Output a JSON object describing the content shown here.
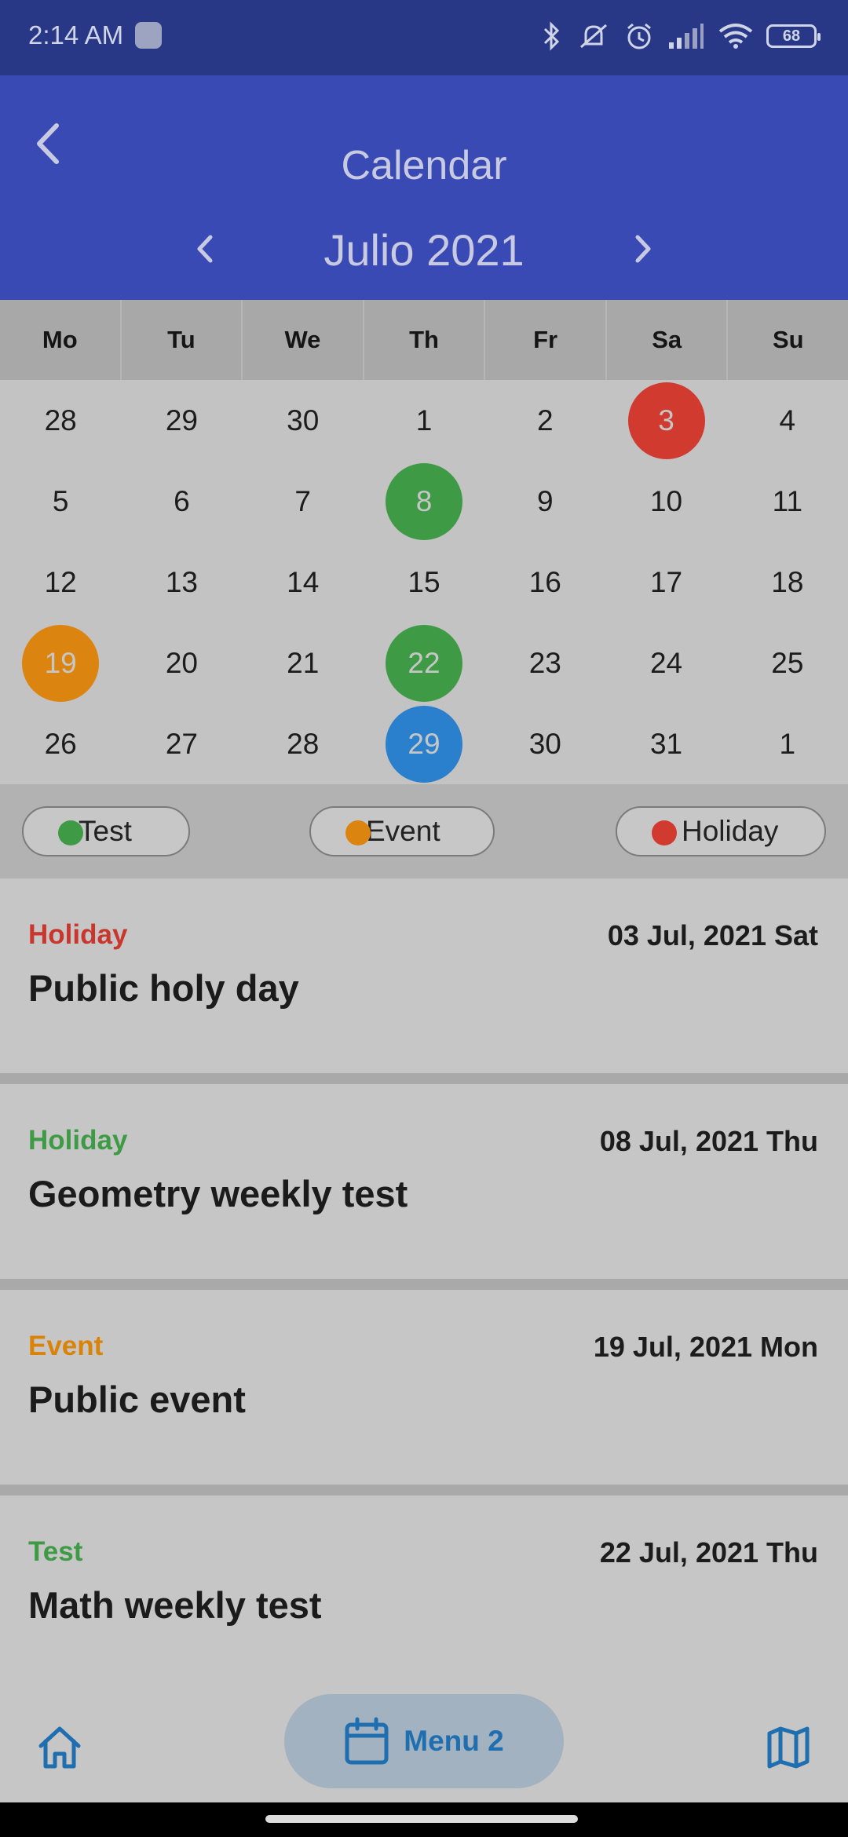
{
  "status": {
    "time": "2:14 AM",
    "battery": "68"
  },
  "header": {
    "title": "Calendar"
  },
  "month_nav": {
    "label": "Julio 2021"
  },
  "weekdays": [
    "Mo",
    "Tu",
    "We",
    "Th",
    "Fr",
    "Sa",
    "Su"
  ],
  "calendar": {
    "weeks": [
      [
        {
          "d": "28"
        },
        {
          "d": "29"
        },
        {
          "d": "30"
        },
        {
          "d": "1"
        },
        {
          "d": "2"
        },
        {
          "d": "3",
          "mark": "#d13a2f"
        },
        {
          "d": "4"
        }
      ],
      [
        {
          "d": "5"
        },
        {
          "d": "6"
        },
        {
          "d": "7"
        },
        {
          "d": "8",
          "mark": "#3f9a45"
        },
        {
          "d": "9"
        },
        {
          "d": "10"
        },
        {
          "d": "11"
        }
      ],
      [
        {
          "d": "12"
        },
        {
          "d": "13"
        },
        {
          "d": "14"
        },
        {
          "d": "15"
        },
        {
          "d": "16"
        },
        {
          "d": "17"
        },
        {
          "d": "18"
        }
      ],
      [
        {
          "d": "19",
          "mark": "#dc8410"
        },
        {
          "d": "20"
        },
        {
          "d": "21"
        },
        {
          "d": "22",
          "mark": "#3f9a45"
        },
        {
          "d": "23"
        },
        {
          "d": "24"
        },
        {
          "d": "25"
        }
      ],
      [
        {
          "d": "26"
        },
        {
          "d": "27"
        },
        {
          "d": "28"
        },
        {
          "d": "29",
          "mark": "#2a80cc"
        },
        {
          "d": "30"
        },
        {
          "d": "31"
        },
        {
          "d": "1"
        }
      ]
    ]
  },
  "legend": [
    {
      "label": "Test",
      "color": "#3f9a45"
    },
    {
      "label": "Event",
      "color": "#dc8410"
    },
    {
      "label": "Holiday",
      "color": "#d13a2f"
    }
  ],
  "events": [
    {
      "category": "Holiday",
      "category_color": "#c9362c",
      "date": "03 Jul, 2021 Sat",
      "title": "Public holy day"
    },
    {
      "category": "Holiday",
      "category_color": "#3f9a45",
      "date": "08 Jul, 2021 Thu",
      "title": "Geometry weekly test"
    },
    {
      "category": "Event",
      "category_color": "#d98309",
      "date": "19 Jul, 2021 Mon",
      "title": "Public event"
    },
    {
      "category": "Test",
      "category_color": "#3f9a45",
      "date": "22 Jul, 2021 Thu",
      "title": "Math weekly test"
    }
  ],
  "bottom_nav": {
    "active_label": "Menu 2",
    "accent": "#1f6fb0"
  },
  "icons": [
    "back-arrow-icon",
    "chevron-left-icon",
    "chevron-right-icon",
    "home-icon",
    "calendar-icon",
    "map-icon",
    "bluetooth-icon",
    "mute-icon",
    "alarm-icon",
    "signal-icon",
    "wifi-icon",
    "battery-icon"
  ]
}
